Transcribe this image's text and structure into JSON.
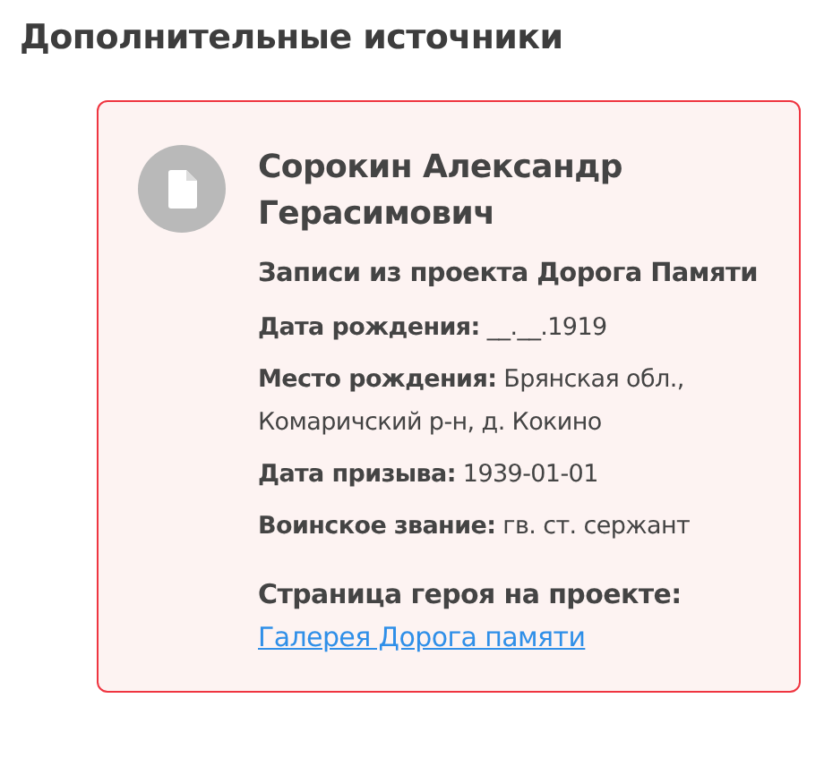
{
  "heading": "Дополнительные источники",
  "card": {
    "name": "Сорокин Александр Герасимович",
    "source": "Записи из проекта Дорога Памяти",
    "fields": [
      {
        "text": "**Дата рождения:** __.__.1919"
      },
      {
        "text": "**Место рождения:** Брянская обл., Комаричский р-н, д. Кокино"
      },
      {
        "text": "**Дата призыва:** 1939-01-01"
      },
      {
        "text": "**Воинское звание:** гв. ст. сержант"
      }
    ],
    "page_label": "Страница героя на проекте:",
    "link": "Галерея Дорога памяти"
  }
}
